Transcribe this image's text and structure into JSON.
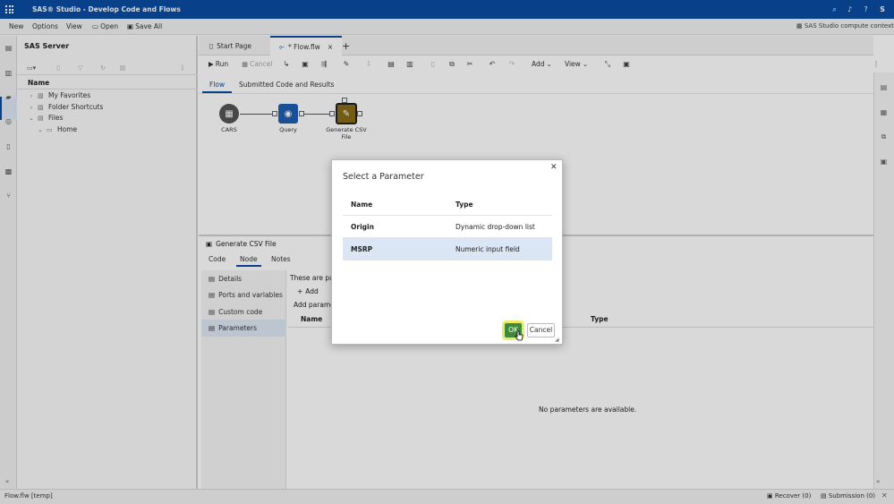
{
  "app": {
    "title": "SAS® Studio - Develop Code and Flows",
    "user_initial": "S"
  },
  "menu": {
    "new": "New",
    "options": "Options",
    "view": "View",
    "open": "Open",
    "save_all": "Save All",
    "context": "SAS Studio compute context"
  },
  "sidebar": {
    "title": "SAS Server",
    "column_header": "Name",
    "tree": [
      {
        "label": "My Favorites"
      },
      {
        "label": "Folder Shortcuts"
      },
      {
        "label": "Files"
      },
      {
        "label": "Home"
      }
    ]
  },
  "tabs": {
    "start": "Start Page",
    "flow": "* Flow.flw"
  },
  "toolbar": {
    "run": "Run",
    "cancel": "Cancel",
    "add": "Add",
    "view": "View"
  },
  "subtabs": {
    "flow": "Flow",
    "submitted": "Submitted Code and Results"
  },
  "flow_nodes": [
    {
      "label": "CARS",
      "icon": "table-icon",
      "color": "#555555"
    },
    {
      "label": "Query",
      "icon": "query-icon",
      "color": "#1f5fae"
    },
    {
      "label": "Generate CSV File",
      "icon": "csv-icon",
      "color": "#8a6d1a"
    }
  ],
  "bottom_panel": {
    "title": "Generate CSV File",
    "tabs": {
      "code": "Code",
      "node": "Node",
      "notes": "Notes"
    },
    "left_items": [
      "Details",
      "Ports and variables",
      "Custom code",
      "Parameters"
    ],
    "content_text": "These are par",
    "add_label": "Add",
    "add_param_text": "Add parame",
    "col_name": "Name",
    "col_type": "Type",
    "empty_message": "No parameters are available."
  },
  "dialog": {
    "title": "Select a Parameter",
    "col_name": "Name",
    "col_type": "Type",
    "rows": [
      {
        "name": "Origin",
        "type": "Dynamic drop-down list"
      },
      {
        "name": "MSRP",
        "type": "Numeric input field"
      }
    ],
    "ok": "OK",
    "cancel": "Cancel",
    "accent_color": "#3f8a3a"
  },
  "status": {
    "file": "Flow.flw [temp]",
    "recover": "Recover (0)",
    "submission": "Submission (0)"
  }
}
